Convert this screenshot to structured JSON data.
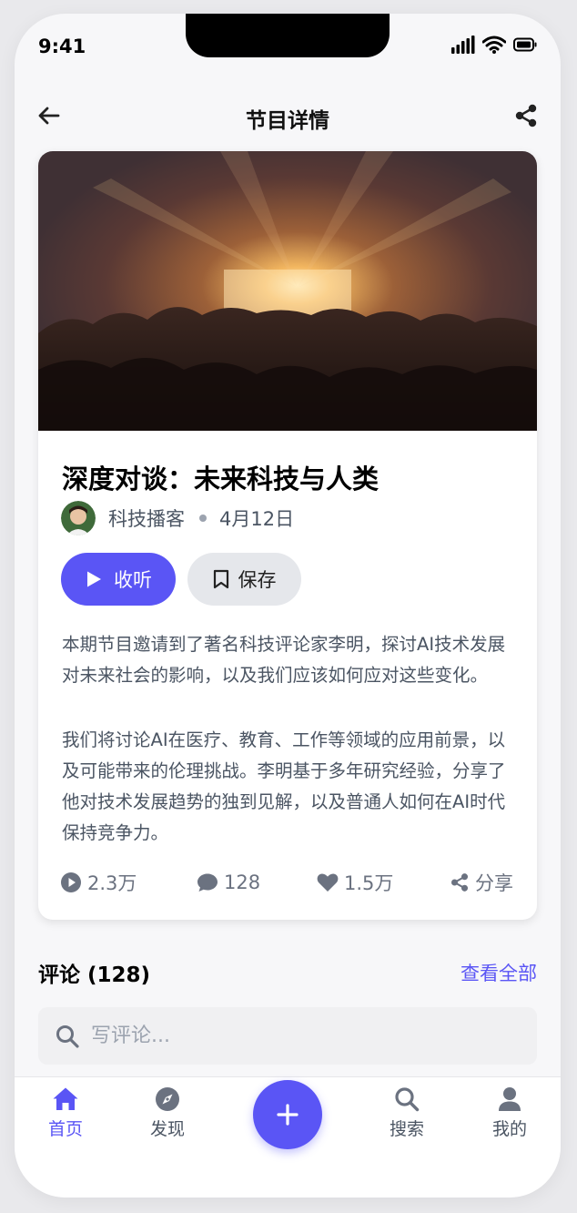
{
  "status_bar": {
    "time": "9:41",
    "icons": [
      "signal-icon",
      "wifi-icon",
      "battery-icon"
    ]
  },
  "header": {
    "title": "节目详情",
    "back_icon": "arrow-left-icon",
    "share_icon": "share-icon"
  },
  "episode": {
    "cover_image": "concert-crowd-stage-lights",
    "title": "深度对谈：未来科技与人类",
    "author": "科技播客",
    "date": "4月12日",
    "listen_label": "收听",
    "save_label": "保存",
    "description": [
      "本期节目邀请到了著名科技评论家李明，探讨AI技术发展对未来社会的影响，以及我们应该如何应对这些变化。",
      "我们将讨论AI在医疗、教育、工作等领域的应用前景，以及可能带来的伦理挑战。李明基于多年研究经验，分享了他对技术发展趋势的独到见解，以及普通人如何在AI时代保持竞争力。"
    ],
    "stats": {
      "plays": "2.3万",
      "comments": "128",
      "likes": "1.5万",
      "share": "分享"
    }
  },
  "comments": {
    "heading": "评论 (128)",
    "see_all": "查看全部",
    "placeholder": "写评论..."
  },
  "tabbar": {
    "items": [
      {
        "label": "首页",
        "icon": "home-icon",
        "active": true
      },
      {
        "label": "发现",
        "icon": "compass-icon",
        "active": false
      },
      {
        "label": "搜索",
        "icon": "search-icon",
        "active": false
      },
      {
        "label": "我的",
        "icon": "user-icon",
        "active": false
      }
    ],
    "fab_icon": "plus-icon"
  },
  "colors": {
    "accent": "#5a55f5",
    "text_muted": "#4b5563",
    "stat_gray": "#6b7280"
  }
}
